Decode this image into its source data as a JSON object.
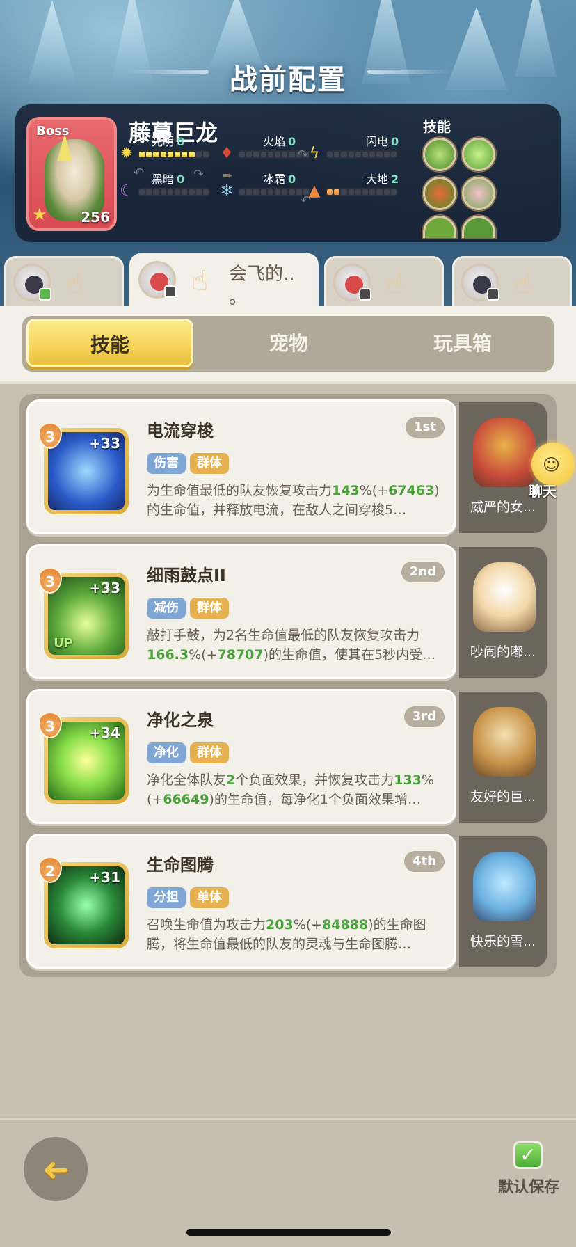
{
  "header": {
    "title": "战前配置"
  },
  "boss": {
    "tag": "Boss",
    "name": "藤蔓巨龙",
    "level": "256",
    "skills_title": "技能",
    "elements": [
      {
        "label": "光明",
        "value": "8",
        "icon": "sun-icon",
        "fill": 8,
        "color": "#f6d84a"
      },
      {
        "label": "火焰",
        "value": "0",
        "icon": "fire-icon",
        "fill": 0,
        "color": "#d84a3a"
      },
      {
        "label": "闪电",
        "value": "0",
        "icon": "lightning-icon",
        "fill": 0,
        "color": "#f6c84a"
      },
      {
        "label": "黑暗",
        "value": "0",
        "icon": "moon-icon",
        "fill": 0,
        "color": "#b66ae0"
      },
      {
        "label": "冰霜",
        "value": "0",
        "icon": "snowflake-icon",
        "fill": 0,
        "color": "#9fd6f0"
      },
      {
        "label": "大地",
        "value": "2",
        "icon": "earth-icon",
        "fill": 2,
        "color": "#f08a3a"
      }
    ]
  },
  "pet_tabs": [
    {
      "label": "",
      "active": false
    },
    {
      "label": "会飞的..\n。",
      "active": true
    },
    {
      "label": "",
      "active": false
    },
    {
      "label": "",
      "active": false
    }
  ],
  "segments": {
    "skills": "技能",
    "pets": "宠物",
    "toybox": "玩具箱",
    "active": "skills"
  },
  "skills": [
    {
      "name": "电流穿梭",
      "rank": "1st",
      "level": "3",
      "plus": "+33",
      "up": "",
      "tags": [
        "伤害",
        "群体"
      ],
      "desc_parts": [
        "为生命值最低的队友恢复攻击力",
        "143",
        "%(+",
        "67463",
        ")的生命值，并释放电流，在敌人之间穿梭5…"
      ],
      "pet": "威严的女..."
    },
    {
      "name": "细雨鼓点II",
      "rank": "2nd",
      "level": "3",
      "plus": "+33",
      "up": "UP",
      "tags": [
        "减伤",
        "群体"
      ],
      "desc_parts": [
        "敲打手鼓，为2名生命值最低的队友恢复攻击力",
        "166.3",
        "%(+",
        "78707",
        ")的生命值，使其在5秒内受…"
      ],
      "pet": "吵闹的嘟..."
    },
    {
      "name": "净化之泉",
      "rank": "3rd",
      "level": "3",
      "plus": "+34",
      "up": "",
      "tags": [
        "净化",
        "群体"
      ],
      "desc_parts": [
        "净化全体队友",
        "2",
        "个负面效果，并恢复攻击力",
        "133",
        "%(+",
        "66649",
        ")的生命值，每净化1个负面效果增…"
      ],
      "pet": "友好的巨..."
    },
    {
      "name": "生命图腾",
      "rank": "4th",
      "level": "2",
      "plus": "+31",
      "up": "",
      "tags": [
        "分担",
        "单体"
      ],
      "desc_parts": [
        "召唤生命值为攻击力",
        "203",
        "%(+",
        "84888",
        ")的生命图腾，将生命值最低的队友的灵魂与生命图腾…"
      ],
      "pet": "快乐的雪..."
    }
  ],
  "chat": {
    "label": "聊天"
  },
  "footer": {
    "save_label": "默认保存"
  }
}
